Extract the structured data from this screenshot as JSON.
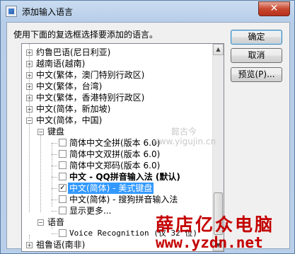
{
  "window": {
    "title": "添加输入语言",
    "close_glyph": "✕"
  },
  "instruction": "使用下面的复选框选择要添加的语言。",
  "tree": {
    "rows": [
      {
        "label": "约鲁巴语(尼日利亚)",
        "level": 0,
        "expander": "+"
      },
      {
        "label": "越南语(越南)",
        "level": 0,
        "expander": "+"
      },
      {
        "label": "中文(繁体，澳门特别行政区)",
        "level": 0,
        "expander": "+"
      },
      {
        "label": "中文(繁体，台湾)",
        "level": 0,
        "expander": "+"
      },
      {
        "label": "中文(繁体，香港特别行政区)",
        "level": 0,
        "expander": "+"
      },
      {
        "label": "中文(简体，新加坡)",
        "level": 0,
        "expander": "+"
      },
      {
        "label": "中文(简体，中国)",
        "level": 0,
        "expander": "−"
      },
      {
        "label": "键盘",
        "level": 1,
        "expander": "−"
      },
      {
        "label": "简体中文全拼(版本 6.0)",
        "level": 2,
        "checkbox": true,
        "checked": false
      },
      {
        "label": "简体中文双拼(版本 6.0)",
        "level": 2,
        "checkbox": true,
        "checked": false
      },
      {
        "label": "简体中文郑码(版本 6.0)",
        "level": 2,
        "checkbox": true,
        "checked": false
      },
      {
        "label": "中文 - QQ拼音输入法 (默认)",
        "level": 2,
        "checkbox": true,
        "checked": false,
        "bold": true
      },
      {
        "label": "中文(简体) - 美式键盘",
        "level": 2,
        "checkbox": true,
        "checked": true,
        "selected": true
      },
      {
        "label": "中文(简体) - 搜狗拼音输入法",
        "level": 2,
        "checkbox": true,
        "checked": false
      },
      {
        "label": "显示更多...",
        "level": 2,
        "checkbox": true,
        "checked": false
      },
      {
        "label": "语音",
        "level": 1,
        "expander": "−"
      },
      {
        "label": "Voice Recognition (仅 32 位)",
        "level": 2,
        "checkbox": true,
        "checked": false,
        "mono": true
      },
      {
        "label": "祖鲁语(南非)",
        "level": 0,
        "expander": "+"
      }
    ]
  },
  "buttons": {
    "ok": "确定",
    "cancel": "取消",
    "preview": "预览(P)..."
  },
  "watermarks": {
    "site_cn": "懿古今",
    "site_url": "www.yigujin.cn",
    "brand_cn": "薛店亿众电脑",
    "brand_url": "www.yzdn.net"
  },
  "colors": {
    "selection": "#3399ff",
    "watermark_red": "#c40000"
  }
}
